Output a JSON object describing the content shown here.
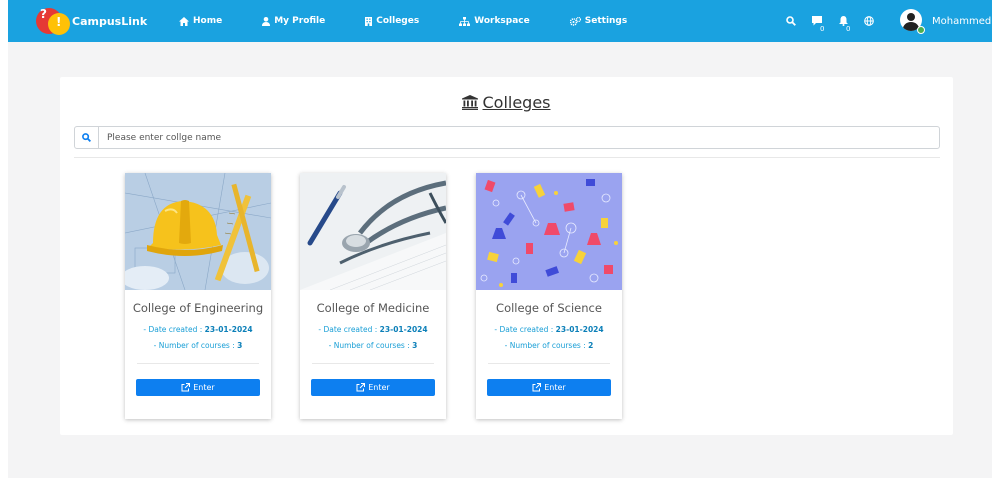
{
  "navbar": {
    "brand": "CampusLink",
    "links": [
      {
        "label": "Home",
        "icon": "home-icon"
      },
      {
        "label": "My Profile",
        "icon": "user-icon"
      },
      {
        "label": "Colleges",
        "icon": "building-icon"
      },
      {
        "label": "Workspace",
        "icon": "sitemap-icon"
      },
      {
        "label": "Settings",
        "icon": "cogs-icon"
      }
    ],
    "messages_count": "0",
    "notifications_count": "0",
    "user_name": "Mohammed",
    "color": "#1aa2e0"
  },
  "page": {
    "title": "Colleges",
    "search_placeholder": "Please enter collge name"
  },
  "colleges": [
    {
      "name": "College of Engineering",
      "date_label": "- Date created : ",
      "date": "23-01-2024",
      "courses_label": "- Number of courses : ",
      "courses": "3",
      "enter_label": "Enter",
      "image": "engineering-helmet-blueprints"
    },
    {
      "name": "College of Medicine",
      "date_label": "- Date created : ",
      "date": "23-01-2024",
      "courses_label": "- Number of courses : ",
      "courses": "3",
      "enter_label": "Enter",
      "image": "stethoscope-pen"
    },
    {
      "name": "College of Science",
      "date_label": "- Date created : ",
      "date": "23-01-2024",
      "courses_label": "- Number of courses : ",
      "courses": "2",
      "enter_label": "Enter",
      "image": "science-pattern"
    }
  ],
  "colors": {
    "enter_button": "#0d7ff0",
    "meta_text": "#1a9fd6"
  }
}
